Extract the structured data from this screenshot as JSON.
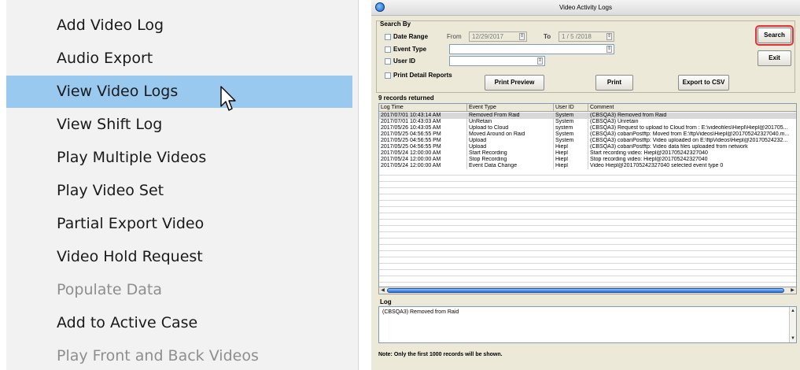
{
  "context_menu": {
    "items": [
      {
        "label": "Add Video Log",
        "state": "normal"
      },
      {
        "label": "Audio Export",
        "state": "normal"
      },
      {
        "label": "View Video Logs",
        "state": "selected"
      },
      {
        "label": "View Shift Log",
        "state": "normal"
      },
      {
        "label": "Play Multiple Videos",
        "state": "normal"
      },
      {
        "label": "Play Video Set",
        "state": "normal"
      },
      {
        "label": "Partial Export Video",
        "state": "normal"
      },
      {
        "label": "Video Hold Request",
        "state": "normal"
      },
      {
        "label": "Populate Data",
        "state": "disabled"
      },
      {
        "label": "Add to Active Case",
        "state": "normal"
      },
      {
        "label": "Play Front and Back Videos",
        "state": "disabled"
      }
    ],
    "colors": {
      "selected_bg": "#99c9ef",
      "disabled_text": "#8e8e8e"
    }
  },
  "window": {
    "title": "Video Activity Logs",
    "search_by": {
      "heading": "Search By",
      "date_range_label": "Date Range",
      "from_label": "From",
      "from_value": "12/29/2017",
      "to_label": "To",
      "to_value": "1 / 5 /2018",
      "event_type_label": "Event Type",
      "event_type_value": "",
      "user_id_label": "User ID",
      "user_id_value": "",
      "print_detail_label": "Print Detail Reports",
      "buttons": {
        "search": "Search",
        "exit": "Exit",
        "print_preview": "Print Preview",
        "print": "Print",
        "export_csv": "Export to CSV"
      }
    },
    "records_label": "9 records returned",
    "grid": {
      "columns": [
        "Log Time",
        "Event Type",
        "User ID",
        "Comment"
      ],
      "rows": [
        [
          "2017/07/01 10:43:14 AM",
          "Removed From Raid",
          "System",
          "(CBSQA3) Removed from Raid"
        ],
        [
          "2017/07/01 10:43:03 AM",
          "UnRetain",
          "System",
          "(CBSQA3) Unretain"
        ],
        [
          "2017/05/26 10:43:05 AM",
          "Upload to Cloud",
          "system",
          "(CBSQA3) Request to upload to Cloud from : E:\\videofiles\\Hiepl\\Hiepl@201705..."
        ],
        [
          "2017/05/25 04:56:55 PM",
          "Moved Around on Raid",
          "System",
          "(CBSQA3) cobanPostftp: Moved from E:\\ftpVideos\\Hiepl@201705242327040.m..."
        ],
        [
          "2017/05/25 04:56:55 PM",
          "Upload",
          "System",
          "(CBSQA3) cobanPostftp: Video uploaded on E:\\ftpVideos\\Hiepl@20170524232..."
        ],
        [
          "2017/05/25 04:56:55 PM",
          "Upload",
          "Hiepl",
          "(CBSQA3) cobanPostftp: Video data files uploaded from network"
        ],
        [
          "2017/05/24 12:00:00 AM",
          "Start Recording",
          "Hiepl",
          "Start recording  video: Hiepl@201705242327040"
        ],
        [
          "2017/05/24 12:00:00 AM",
          "Stop Recording",
          "Hiepl",
          "Stop recording  video: Hiepl@201705242327040"
        ],
        [
          "2017/05/24 12:00:00 AM",
          "Event Data Change",
          "Hiepl",
          "Video Hiepl@201705242327040 selected event type 0"
        ]
      ],
      "selected_row": 0
    },
    "log_label": "Log",
    "log_text": "(CBSQA3) Removed from Raid",
    "note": "Note: Only the first 1000 records will be shown.",
    "colors": {
      "search_highlight": "#e0303a",
      "window_bg": "#ece9d8"
    }
  },
  "icons": {
    "pointer": "mouse-pointer-icon",
    "app": "app-globe-icon",
    "spin": "spin-updown-icon"
  }
}
